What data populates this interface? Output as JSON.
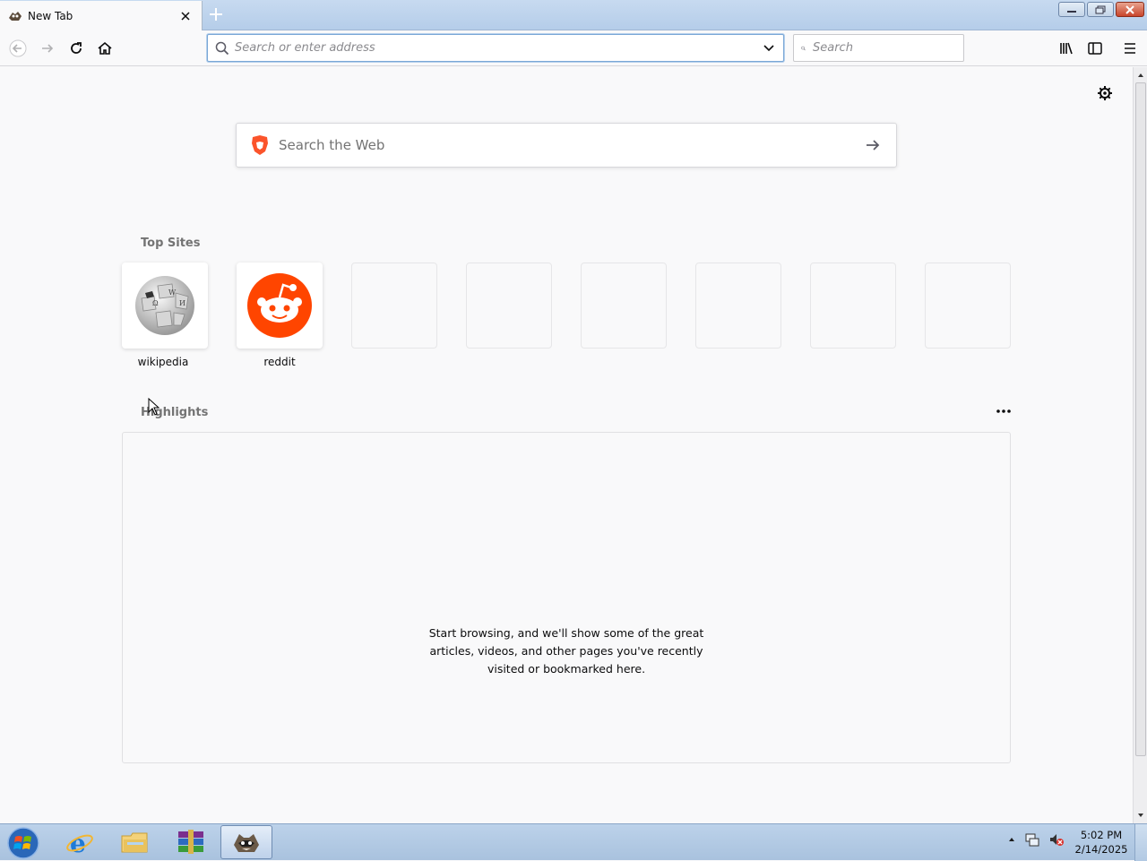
{
  "window": {
    "tab_title": "New Tab",
    "favicon": "raccoon-browser-icon"
  },
  "navbar": {
    "url_placeholder": "Search or enter address",
    "search_placeholder": "Search"
  },
  "newtab": {
    "web_search_placeholder": "Search the Web",
    "top_sites_heading": "Top Sites",
    "top_sites": [
      {
        "label": "wikipedia",
        "icon": "wikipedia-globe-icon"
      },
      {
        "label": "reddit",
        "icon": "reddit-alien-icon"
      }
    ],
    "highlights_heading": "Highlights",
    "highlights_message": "Start browsing, and we'll show some of the great articles, videos, and other pages you've recently visited or bookmarked here."
  },
  "taskbar": {
    "apps": [
      "internet-explorer-icon",
      "file-explorer-icon",
      "winrar-icon",
      "browser-raccoon-icon"
    ],
    "time": "5:02 PM",
    "date": "2/14/2025"
  },
  "colors": {
    "accent": "#0a84ff",
    "reddit": "#ff4500",
    "brave": "#fb542b"
  }
}
